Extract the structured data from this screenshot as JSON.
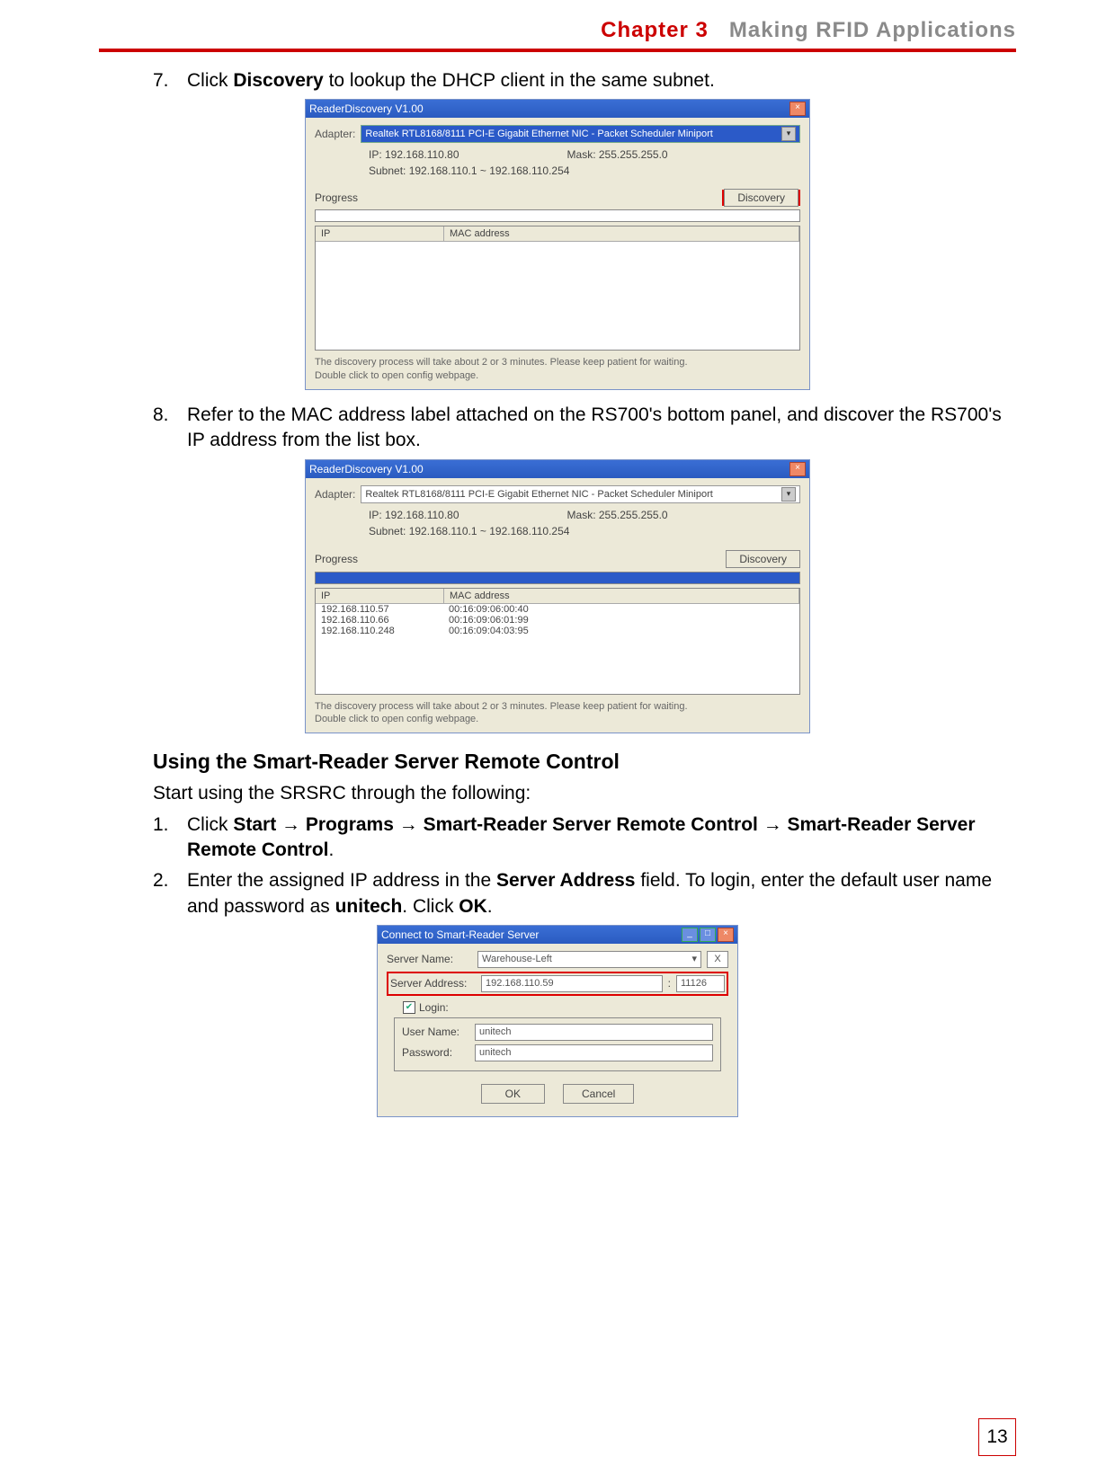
{
  "header": {
    "chapter": "Chapter 3",
    "title": "Making RFID Applications"
  },
  "steps": {
    "s7": {
      "num": "7.",
      "pre": "Click ",
      "bold": "Discovery",
      "post": " to lookup the DHCP client in the same subnet."
    },
    "s8": {
      "num": "8.",
      "text": "Refer to the MAC address label attached on the RS700's bottom panel, and discover the RS700's IP address from the list box."
    }
  },
  "fig1": {
    "title": "ReaderDiscovery V1.00",
    "adapter_lbl": "Adapter:",
    "adapter_val": "Realtek RTL8168/8111 PCI-E Gigabit Ethernet NIC - Packet Scheduler Miniport",
    "ip_lbl": "IP: 192.168.110.80",
    "mask_lbl": "Mask: 255.255.255.0",
    "subnet_lbl": "Subnet: 192.168.110.1 ~ 192.168.110.254",
    "progress_lbl": "Progress",
    "discovery_btn": "Discovery",
    "col_ip": "IP",
    "col_mac": "MAC address",
    "note1": "The discovery process will take about 2 or 3 minutes. Please keep patient for waiting.",
    "note2": "Double click to open config webpage."
  },
  "fig2": {
    "title": "ReaderDiscovery V1.00",
    "adapter_lbl": "Adapter:",
    "adapter_val": "Realtek RTL8168/8111 PCI-E Gigabit Ethernet NIC - Packet Scheduler Miniport",
    "ip_lbl": "IP: 192.168.110.80",
    "mask_lbl": "Mask: 255.255.255.0",
    "subnet_lbl": "Subnet: 192.168.110.1 ~ 192.168.110.254",
    "progress_lbl": "Progress",
    "discovery_btn": "Discovery",
    "col_ip": "IP",
    "col_mac": "MAC address",
    "rows": [
      {
        "ip": "192.168.110.57",
        "mac": "00:16:09:06:00:40"
      },
      {
        "ip": "192.168.110.66",
        "mac": "00:16:09:06:01:99"
      },
      {
        "ip": "192.168.110.248",
        "mac": "00:16:09:04:03:95"
      }
    ],
    "note1": "The discovery process will take about 2 or 3 minutes. Please keep patient for waiting.",
    "note2": "Double click to open config webpage."
  },
  "section": {
    "heading": "Using the Smart-Reader Server Remote Control",
    "intro": "Start using the SRSRC through the following:",
    "s1": {
      "num": "1.",
      "a": "Click ",
      "b": "Start",
      "c": " → ",
      "d": "Programs",
      "e": " → ",
      "f": "Smart-Reader Server Remote Control",
      "g": " → ",
      "h": "Smart-Reader Server Remote Control",
      "i": "."
    },
    "s2": {
      "num": "2.",
      "a": "Enter the assigned IP address in the ",
      "b": "Server Address",
      "c": " field. To login, enter the default user name and password as ",
      "d": "unitech",
      "e": ". Click ",
      "f": "OK",
      "g": "."
    }
  },
  "fig3": {
    "title": "Connect to Smart-Reader Server",
    "server_name_lbl": "Server Name:",
    "server_name_val": "Warehouse-Left",
    "server_addr_lbl": "Server Address:",
    "server_addr_val": "192.168.110.59",
    "port_val": "11126",
    "login_lbl": "Login:",
    "user_lbl": "User Name:",
    "user_val": "unitech",
    "pass_lbl": "Password:",
    "pass_val": "unitech",
    "ok": "OK",
    "cancel": "Cancel"
  },
  "page_number": "13"
}
